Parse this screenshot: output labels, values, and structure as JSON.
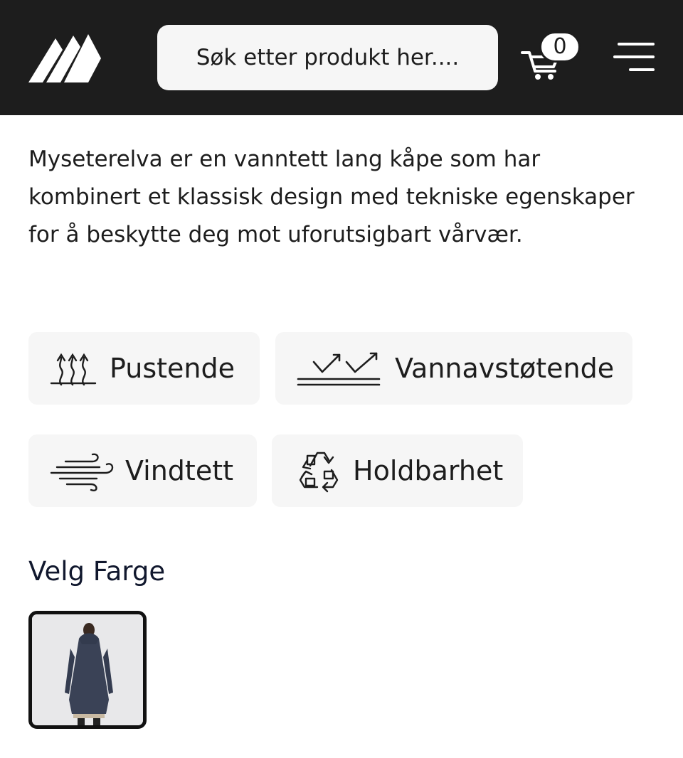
{
  "header": {
    "logo_name": "brand-logo",
    "search": {
      "placeholder": "Søk etter produkt her...."
    },
    "cart": {
      "count": "0"
    }
  },
  "product": {
    "description": "Myseterelva er en vanntett lang kåpe som har kombinert et klassisk design med tekniske egenskaper for å beskytte deg mot uforutsigbart vårvær."
  },
  "features": [
    {
      "label": "Pustende",
      "icon": "breathable-icon"
    },
    {
      "label": "Vannavstøtende",
      "icon": "water-repellent-icon"
    },
    {
      "label": "Vindtett",
      "icon": "windproof-icon"
    },
    {
      "label": "Holdbarhet",
      "icon": "recycle-icon"
    }
  ],
  "color_section": {
    "title": "Velg Farge",
    "swatches": [
      {
        "name": "navy",
        "color": "#3a4256"
      }
    ]
  },
  "colors": {
    "header_bg": "#1d1d1d",
    "chip_bg": "#f6f6f6",
    "text": "#1d1d1d"
  }
}
